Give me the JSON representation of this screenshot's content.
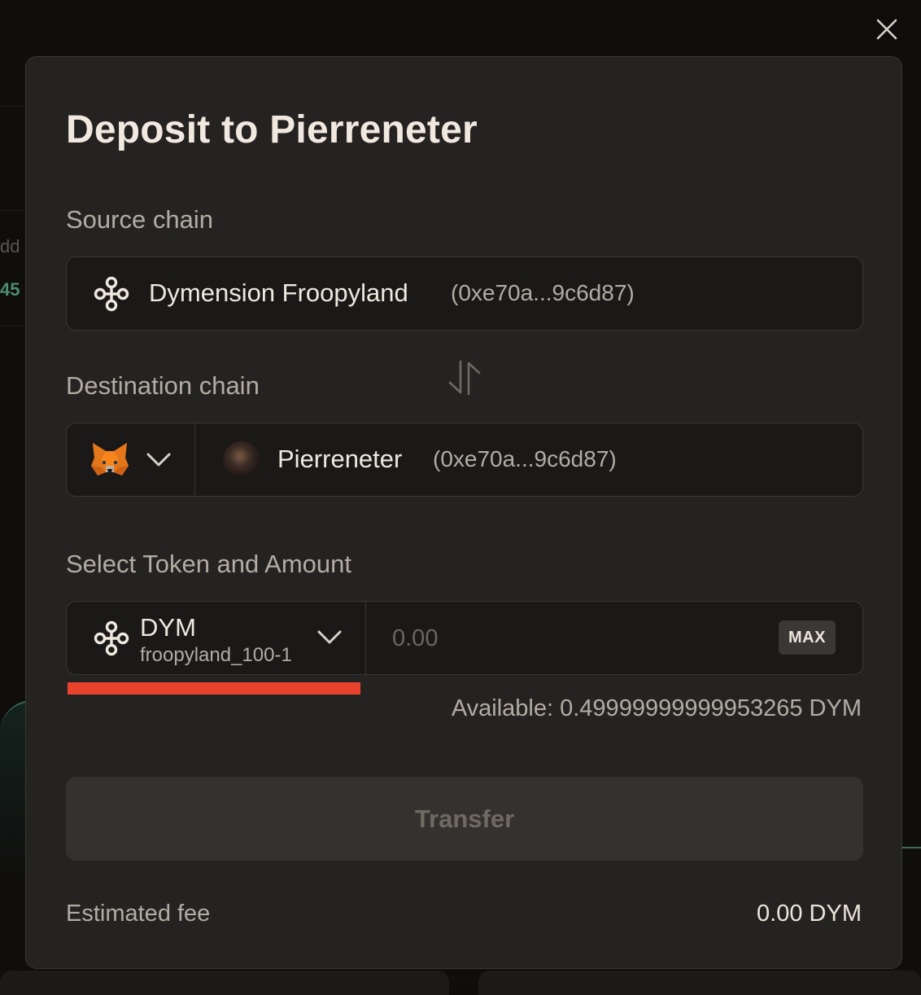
{
  "background": {
    "partial_text_1": "dd",
    "partial_text_2": "45"
  },
  "modal": {
    "title": "Deposit to Pierreneter",
    "source": {
      "label": "Source chain",
      "chain_name": "Dymension Froopyland",
      "address": "(0xe70a...9c6d87)",
      "icon": "dymension-icon"
    },
    "destination": {
      "label": "Destination chain",
      "wallet_icon": "metamask-fox-icon",
      "chain_name": "Pierreneter",
      "address": "(0xe70a...9c6d87)",
      "icon": "pierreneter-avatar"
    },
    "token": {
      "label": "Select Token and Amount",
      "symbol": "DYM",
      "network": "froopyland_100-1",
      "amount_placeholder": "0.00",
      "max_label": "MAX"
    },
    "available": "Available: 0.49999999999953265 DYM",
    "transfer_label": "Transfer",
    "fee": {
      "label": "Estimated fee",
      "value": "0.00 DYM"
    }
  },
  "colors": {
    "modal_bg": "#252321",
    "field_bg": "#1a1918",
    "accent_red": "#e8422c",
    "text_primary": "#efe8df",
    "text_secondary": "#b3aca4"
  }
}
